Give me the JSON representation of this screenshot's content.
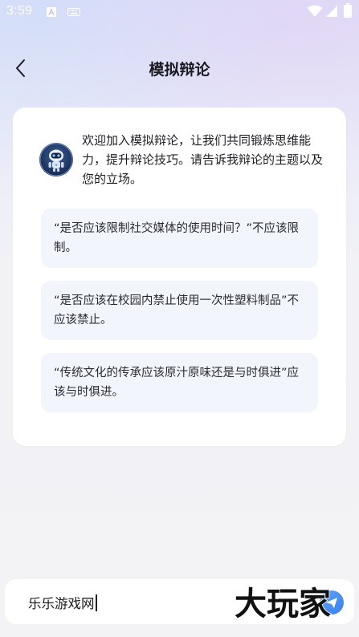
{
  "status_bar": {
    "time": "3:59",
    "icons": [
      "a-notification-icon",
      "keyboard-icon",
      "wifi-icon",
      "cellular-icon",
      "battery-icon"
    ]
  },
  "header": {
    "title": "模拟辩论",
    "back_icon": "chevron-left-icon"
  },
  "chat": {
    "avatar_icon": "robot-avatar-icon",
    "intro_message": "欢迎加入模拟辩论，让我们共同锻炼思维能力，提升辩论技巧。请告诉我辩论的主题以及您的立场。",
    "suggestions": [
      "“是否应该限制社交媒体的使用时间？”不应该限制。",
      "“是否应该在校园内禁止使用一次性塑料制品”不应该禁止。",
      "“传统文化的传承应该原汁原味还是与时俱进”应该与时俱进。"
    ]
  },
  "input": {
    "value": "乐乐游戏网",
    "send_icon": "send-icon"
  },
  "watermark": {
    "text": "大玩家"
  },
  "colors": {
    "accent": "#3b7ff0",
    "suggestion_bg": "#f3f5fd",
    "card_bg": "#ffffff"
  }
}
